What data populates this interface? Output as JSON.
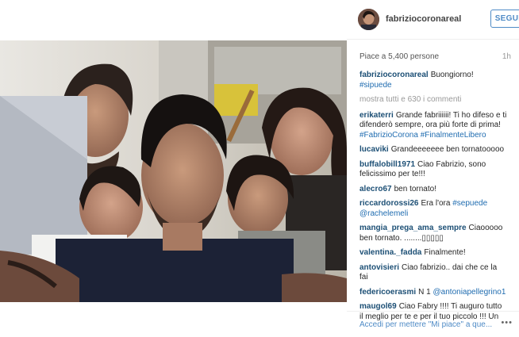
{
  "post": {
    "username": "fabriziocoronareal",
    "follow_label": "SEGUI",
    "likes": "Piace a 5,400 persone",
    "time": "1h",
    "caption_user": "fabriziocoronareal",
    "caption_text": "Buongiorno!",
    "caption_tag": "#sipuede",
    "view_all": "mostra tutti e 630 i commenti",
    "footer_prompt": "Accedi per mettere \"Mi piace\" a que...",
    "more_icon": "more-options-icon"
  },
  "comments": [
    {
      "user": "erikaterri",
      "text": "Grande fabriiiiii! Ti ho difeso e ti difenderò sempre, ora più forte di prima! #FabrizioCorona #FinalmenteLibero"
    },
    {
      "user": "lucaviki",
      "text": "Grandeeeeeee ben tornatooooo"
    },
    {
      "user": "buffalobill1971",
      "text": "Ciao Fabrizio, sono felicissimo per te!!!"
    },
    {
      "user": "alecro67",
      "text": "ben tornato!"
    },
    {
      "user": "riccardorossi26",
      "text": "Era l'ora #sepuede @rachelemeli"
    },
    {
      "user": "mangia_prega_ama_sempre",
      "text": "Ciaooooo ben tornato. ........▯▯▯▯▯"
    },
    {
      "user": "valentina._fadda",
      "text": "Finalmente!"
    },
    {
      "user": "antovisieri",
      "text": "Ciao fabrizio.. dai che ce la fai"
    },
    {
      "user": "federicoerasmi",
      "text": "N 1 @antoniapellegrino1"
    },
    {
      "user": "maugol69",
      "text": "Ciao Fabry !!!! Ti auguro tutto il meglio per te e per il tuo piccolo !!! Un"
    }
  ]
}
